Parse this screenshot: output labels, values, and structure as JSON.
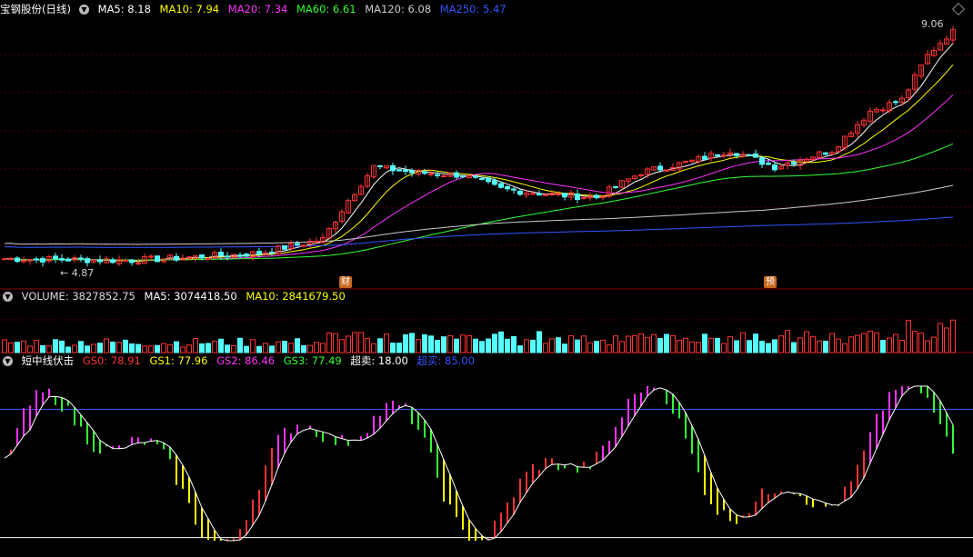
{
  "main_legend": {
    "title": "宝钢股份(日线)",
    "items": [
      {
        "text": "MA5: 8.18",
        "color": "#ffffff"
      },
      {
        "text": "MA10: 7.94",
        "color": "#ffff00"
      },
      {
        "text": "MA20: 7.34",
        "color": "#ff33ff"
      },
      {
        "text": "MA60: 6.61",
        "color": "#33ff33"
      },
      {
        "text": "MA120: 6.08",
        "color": "#cccccc"
      },
      {
        "text": "MA250: 5.47",
        "color": "#3355ff"
      }
    ]
  },
  "volume_legend": {
    "items": [
      {
        "text": "VOLUME: 3827852.75",
        "color": "#dddddd"
      },
      {
        "text": "MA5: 3074418.50",
        "color": "#ffffff"
      },
      {
        "text": "MA10: 2841679.50",
        "color": "#ffff00"
      }
    ]
  },
  "indicator_legend": {
    "title": "短中线伏击",
    "items": [
      {
        "text": "GS0: 78.91",
        "color": "#ff3333"
      },
      {
        "text": "GS1: 77.96",
        "color": "#ffff00"
      },
      {
        "text": "GS2: 86.46",
        "color": "#ff33ff"
      },
      {
        "text": "GS3: 77.49",
        "color": "#33ff33"
      },
      {
        "text": "超卖: 18.00",
        "color": "#ffffff"
      },
      {
        "text": "超买: 85.00",
        "color": "#3355ff"
      }
    ]
  },
  "badges": [
    "财",
    "预"
  ],
  "chart_data": {
    "type": "candlestick",
    "price_high_label": "9.06",
    "price_low_label": "4.87",
    "anchors": [
      {
        "i": 0,
        "close": 4.95
      },
      {
        "i": 20,
        "close": 4.92
      },
      {
        "i": 30,
        "close": 4.98
      },
      {
        "i": 40,
        "close": 5.05
      },
      {
        "i": 50,
        "close": 5.3
      },
      {
        "i": 54,
        "close": 6.0
      },
      {
        "i": 58,
        "close": 6.6
      },
      {
        "i": 64,
        "close": 6.5
      },
      {
        "i": 72,
        "close": 6.45
      },
      {
        "i": 78,
        "close": 6.2
      },
      {
        "i": 86,
        "close": 6.1
      },
      {
        "i": 93,
        "close": 6.05
      },
      {
        "i": 100,
        "close": 6.5
      },
      {
        "i": 108,
        "close": 6.7
      },
      {
        "i": 114,
        "close": 6.9
      },
      {
        "i": 121,
        "close": 6.6
      },
      {
        "i": 130,
        "close": 6.9
      },
      {
        "i": 136,
        "close": 7.6
      },
      {
        "i": 141,
        "close": 7.8
      },
      {
        "i": 145,
        "close": 8.6
      },
      {
        "i": 149,
        "close": 9.06
      }
    ],
    "indicator_levels": {
      "oversold": 18.0,
      "overbought": 85.0
    }
  }
}
